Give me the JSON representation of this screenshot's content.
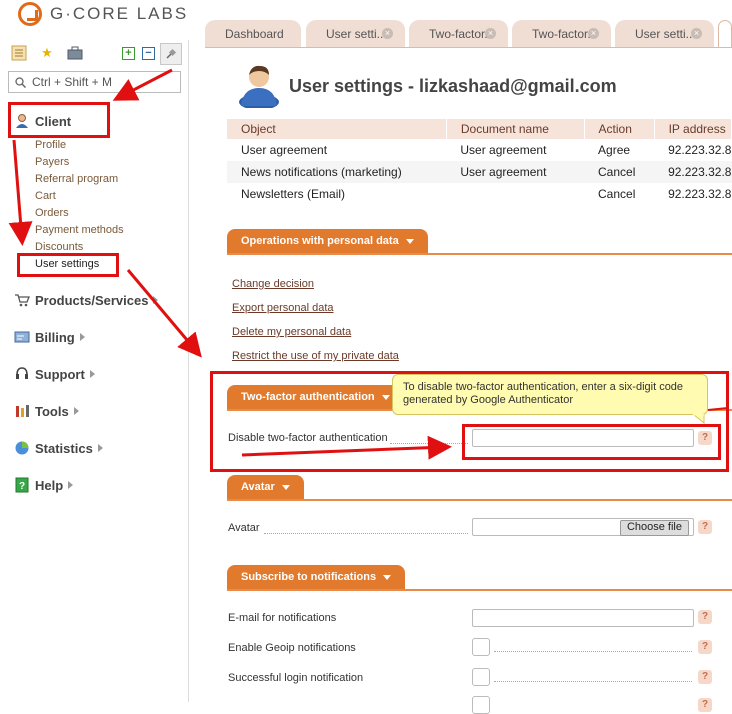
{
  "brand": {
    "name": "G·CORE LABS"
  },
  "search": {
    "placeholder": "Ctrl + Shift + M"
  },
  "sidebar": {
    "client": "Client",
    "client_items": [
      "Profile",
      "Payers",
      "Referral program",
      "Cart",
      "Orders",
      "Payment methods",
      "Discounts",
      "User settings"
    ],
    "sections": [
      "Products/Services",
      "Billing",
      "Support",
      "Tools",
      "Statistics",
      "Help"
    ]
  },
  "tabs": [
    "Dashboard",
    "User setti...",
    "Two-factor...",
    "Two-factor...",
    "User setti..."
  ],
  "page": {
    "title": "User settings - lizkashaad@gmail.com"
  },
  "log_table": {
    "headers": [
      "Object",
      "Document name",
      "Action",
      "IP address"
    ],
    "rows": [
      [
        "User agreement",
        "User agreement",
        "Agree",
        "92.223.32.8"
      ],
      [
        "News notifications (marketing)",
        "User agreement",
        "Cancel",
        "92.223.32.8"
      ],
      [
        "Newsletters (Email)",
        "",
        "Cancel",
        "92.223.32.8"
      ]
    ]
  },
  "personal_data": {
    "header": "Operations with personal data",
    "links": [
      "Change decision",
      "Export personal data",
      "Delete my personal data",
      "Restrict the use of my private data"
    ]
  },
  "twofa": {
    "header": "Two-factor authentication",
    "tooltip": "To disable two-factor authentication, enter a six-digit code generated by Google Authenticator",
    "field_label": "Disable two-factor authentication"
  },
  "avatar": {
    "header": "Avatar",
    "field_label": "Avatar",
    "button": "Choose file"
  },
  "notifications": {
    "header": "Subscribe to notifications",
    "email_label": "E-mail for notifications",
    "geoip_label": "Enable Geoip notifications",
    "login_label": "Successful login notification"
  },
  "help_mark": "?",
  "colors": {
    "accent": "#e27a2e",
    "annotation": "#e01010",
    "link": "#6b3a28"
  }
}
